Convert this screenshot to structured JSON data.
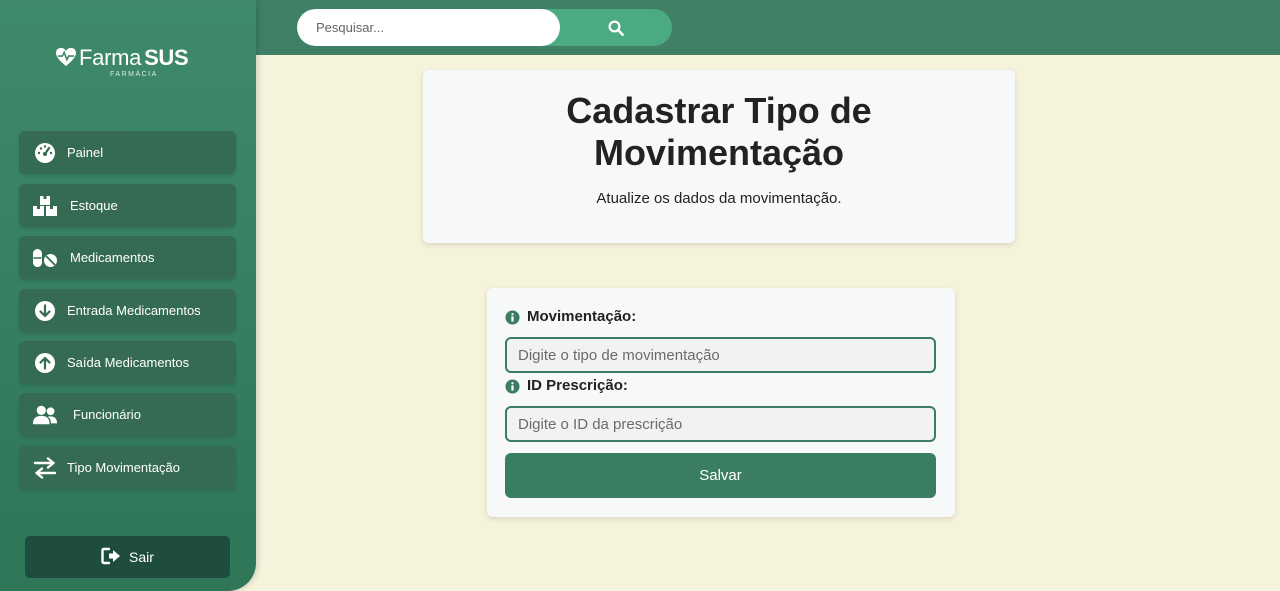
{
  "brand": {
    "name_light": "Farma",
    "name_bold": "SUS",
    "subtitle": "FARMÁCIA"
  },
  "search": {
    "placeholder": "Pesquisar..."
  },
  "sidebar": {
    "items": [
      {
        "label": "Painel",
        "icon": "gauge-icon"
      },
      {
        "label": "Estoque",
        "icon": "boxes-icon"
      },
      {
        "label": "Medicamentos",
        "icon": "pills-icon"
      },
      {
        "label": "Entrada Medicamentos",
        "icon": "arrow-down-circle-icon"
      },
      {
        "label": "Saída Medicamentos",
        "icon": "arrow-up-circle-icon"
      },
      {
        "label": "Funcionário",
        "icon": "users-icon"
      },
      {
        "label": "Tipo Movimentação",
        "icon": "exchange-icon"
      }
    ],
    "logout_label": "Sair"
  },
  "header": {
    "title_line1": "Cadastrar Tipo de",
    "title_line2": "Movimentação",
    "subtitle": "Atualize os dados da movimentação."
  },
  "form": {
    "movement_label": "Movimentação:",
    "movement_placeholder": "Digite o tipo de movimentação",
    "prescription_label": "ID Prescrição:",
    "prescription_placeholder": "Digite o ID da prescrição",
    "save_label": "Salvar"
  },
  "colors": {
    "topbar": "#3f8066",
    "sidebar": "#3f8a6c",
    "nav_item": "#356b52",
    "logout": "#1e4d3f",
    "accent": "#3b7d63",
    "search_button": "#4caa80",
    "background": "#f5f3dc"
  }
}
